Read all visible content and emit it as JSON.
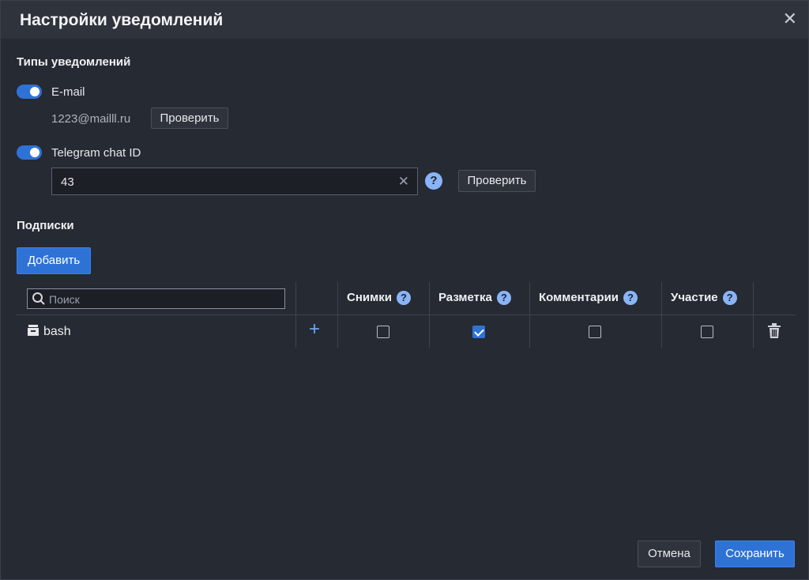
{
  "dialog": {
    "title": "Настройки уведомлений",
    "close_glyph": "✕"
  },
  "notification_types": {
    "section_title": "Типы уведомлений",
    "email": {
      "enabled": true,
      "label": "E-mail",
      "address": "1223@mailll.ru",
      "check_button": "Проверить"
    },
    "telegram": {
      "enabled": true,
      "label": "Telegram chat ID",
      "input_value": "43",
      "clear_glyph": "✕",
      "help_glyph": "?",
      "check_button": "Проверить"
    }
  },
  "subscriptions": {
    "section_title": "Подписки",
    "add_button": "Добавить",
    "search_placeholder": "Поиск",
    "columns": [
      {
        "label": "Снимки",
        "help": "?"
      },
      {
        "label": "Разметка",
        "help": "?"
      },
      {
        "label": "Комментарии",
        "help": "?"
      },
      {
        "label": "Участие",
        "help": "?"
      }
    ],
    "rows": [
      {
        "name": "bash",
        "add_glyph": "+",
        "snapshots": false,
        "markup": true,
        "comments": false,
        "participation": false
      }
    ]
  },
  "footer": {
    "cancel_button": "Отмена",
    "save_button": "Сохранить"
  },
  "colors": {
    "accent": "#2f72d6",
    "help_icon": "#8ab4f8",
    "background": "#262a33",
    "header": "#2f333c"
  }
}
